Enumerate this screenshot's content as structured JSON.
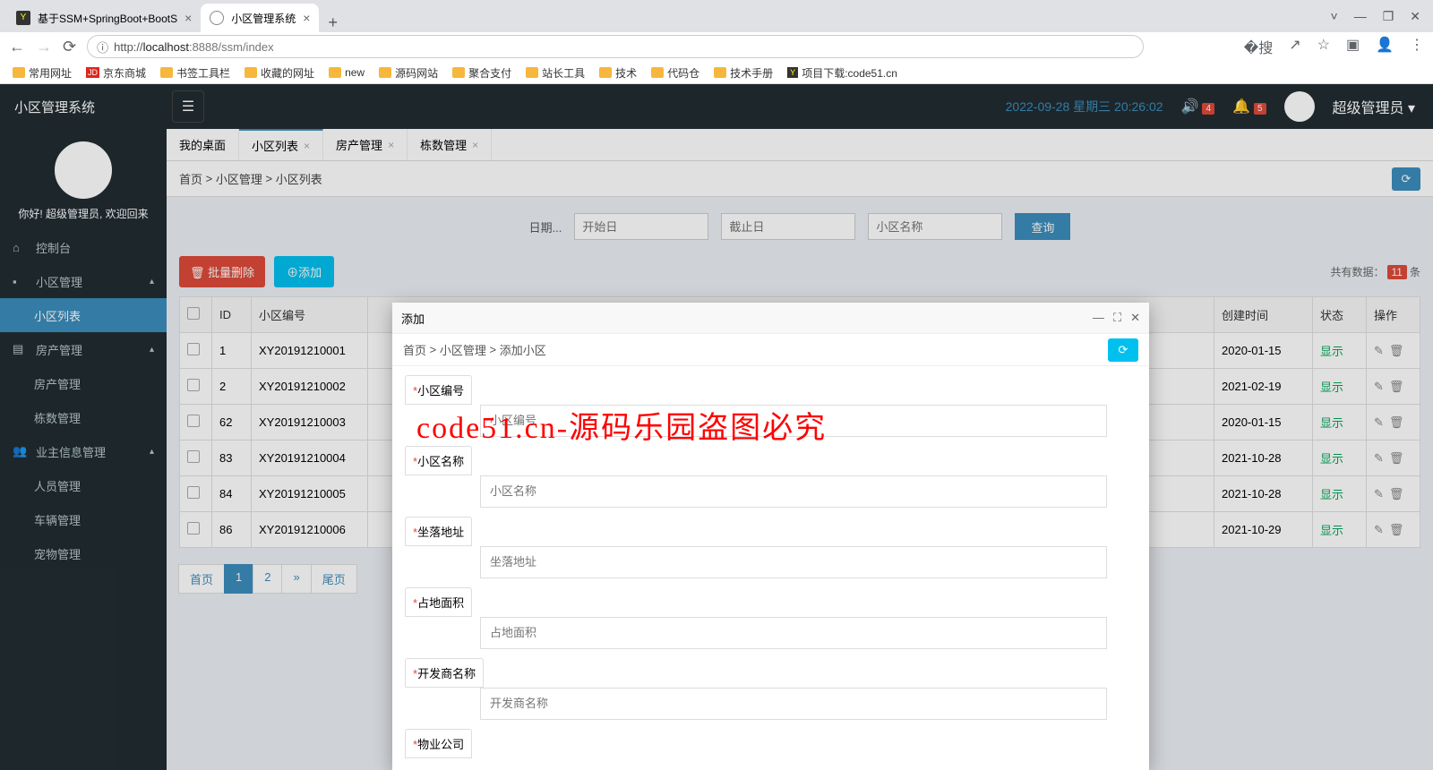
{
  "browser": {
    "tabs": [
      {
        "title": "基于SSM+SpringBoot+BootS",
        "active": false
      },
      {
        "title": "小区管理系统",
        "active": true
      }
    ],
    "url_host": "localhost",
    "url_port": ":8888",
    "url_path": "/ssm/index",
    "url_prefix": "http://",
    "bookmarks": [
      "常用网址",
      "京东商城",
      "书签工具栏",
      "收藏的网址",
      "new",
      "源码网站",
      "聚合支付",
      "站长工具",
      "技术",
      "代码仓",
      "技术手册",
      "项目下载:code51.cn"
    ]
  },
  "app": {
    "title": "小区管理系统",
    "datetime": "2022-09-28  星期三  20:26:02",
    "badge1": "4",
    "badge2": "5",
    "username": "超级管理员"
  },
  "sidebar": {
    "welcome_pre": "你好! ",
    "welcome_user": "超级管理员",
    "welcome_suf": ", 欢迎回来",
    "items": [
      {
        "label": "控制台",
        "icon": "⌂"
      },
      {
        "label": "小区管理",
        "icon": "■",
        "expand": true
      },
      {
        "label": "小区列表",
        "sub": true,
        "active": true
      },
      {
        "label": "房产管理",
        "icon": "▤",
        "expand": true
      },
      {
        "label": "房产管理",
        "sub": true
      },
      {
        "label": "栋数管理",
        "sub": true
      },
      {
        "label": "业主信息管理",
        "icon": "👥",
        "expand": true
      },
      {
        "label": "人员管理",
        "sub": true
      },
      {
        "label": "车辆管理",
        "sub": true
      },
      {
        "label": "宠物管理",
        "sub": true
      }
    ]
  },
  "pageTabs": [
    {
      "label": "我的桌面"
    },
    {
      "label": "小区列表",
      "active": true,
      "closable": true
    },
    {
      "label": "房产管理",
      "closable": true
    },
    {
      "label": "栋数管理",
      "closable": true
    }
  ],
  "breadcrumb": [
    "首页",
    "小区管理",
    "小区列表"
  ],
  "search": {
    "date_label": "日期...",
    "start_ph": "开始日",
    "end_ph": "截止日",
    "name_ph": "小区名称",
    "query_btn": "查询"
  },
  "toolbar": {
    "batch_delete": "批量删除",
    "add": "添加",
    "total_label_pre": "共有数据：",
    "total_count": "11",
    "total_label_suf": "条"
  },
  "table": {
    "headers": [
      "",
      "ID",
      "小区编号",
      "",
      "创建时间",
      "状态",
      "操作"
    ],
    "rows": [
      {
        "id": "1",
        "code": "XY20191210001",
        "created": "2020-01-15",
        "status": "显示"
      },
      {
        "id": "2",
        "code": "XY20191210002",
        "created": "2021-02-19",
        "status": "显示"
      },
      {
        "id": "62",
        "code": "XY20191210003",
        "created": "2020-01-15",
        "status": "显示"
      },
      {
        "id": "83",
        "code": "XY20191210004",
        "created": "2021-10-28",
        "status": "显示"
      },
      {
        "id": "84",
        "code": "XY20191210005",
        "created": "2021-10-28",
        "status": "显示"
      },
      {
        "id": "86",
        "code": "XY20191210006",
        "created": "2021-10-29",
        "status": "显示"
      }
    ]
  },
  "pagination": [
    "首页",
    "1",
    "2",
    "»",
    "尾页"
  ],
  "modal": {
    "title": "添加",
    "breadcrumb": [
      "首页",
      "小区管理",
      "添加小区"
    ],
    "fields": [
      {
        "label": "小区编号",
        "ph": "小区编号"
      },
      {
        "label": "小区名称",
        "ph": "小区名称"
      },
      {
        "label": "坐落地址",
        "ph": "坐落地址"
      },
      {
        "label": "占地面积",
        "ph": "占地面积"
      },
      {
        "label": "开发商名称",
        "ph": "开发商名称"
      },
      {
        "label": "物业公司",
        "ph": ""
      }
    ]
  },
  "watermark": "code51.cn-源码乐园盗图必究"
}
